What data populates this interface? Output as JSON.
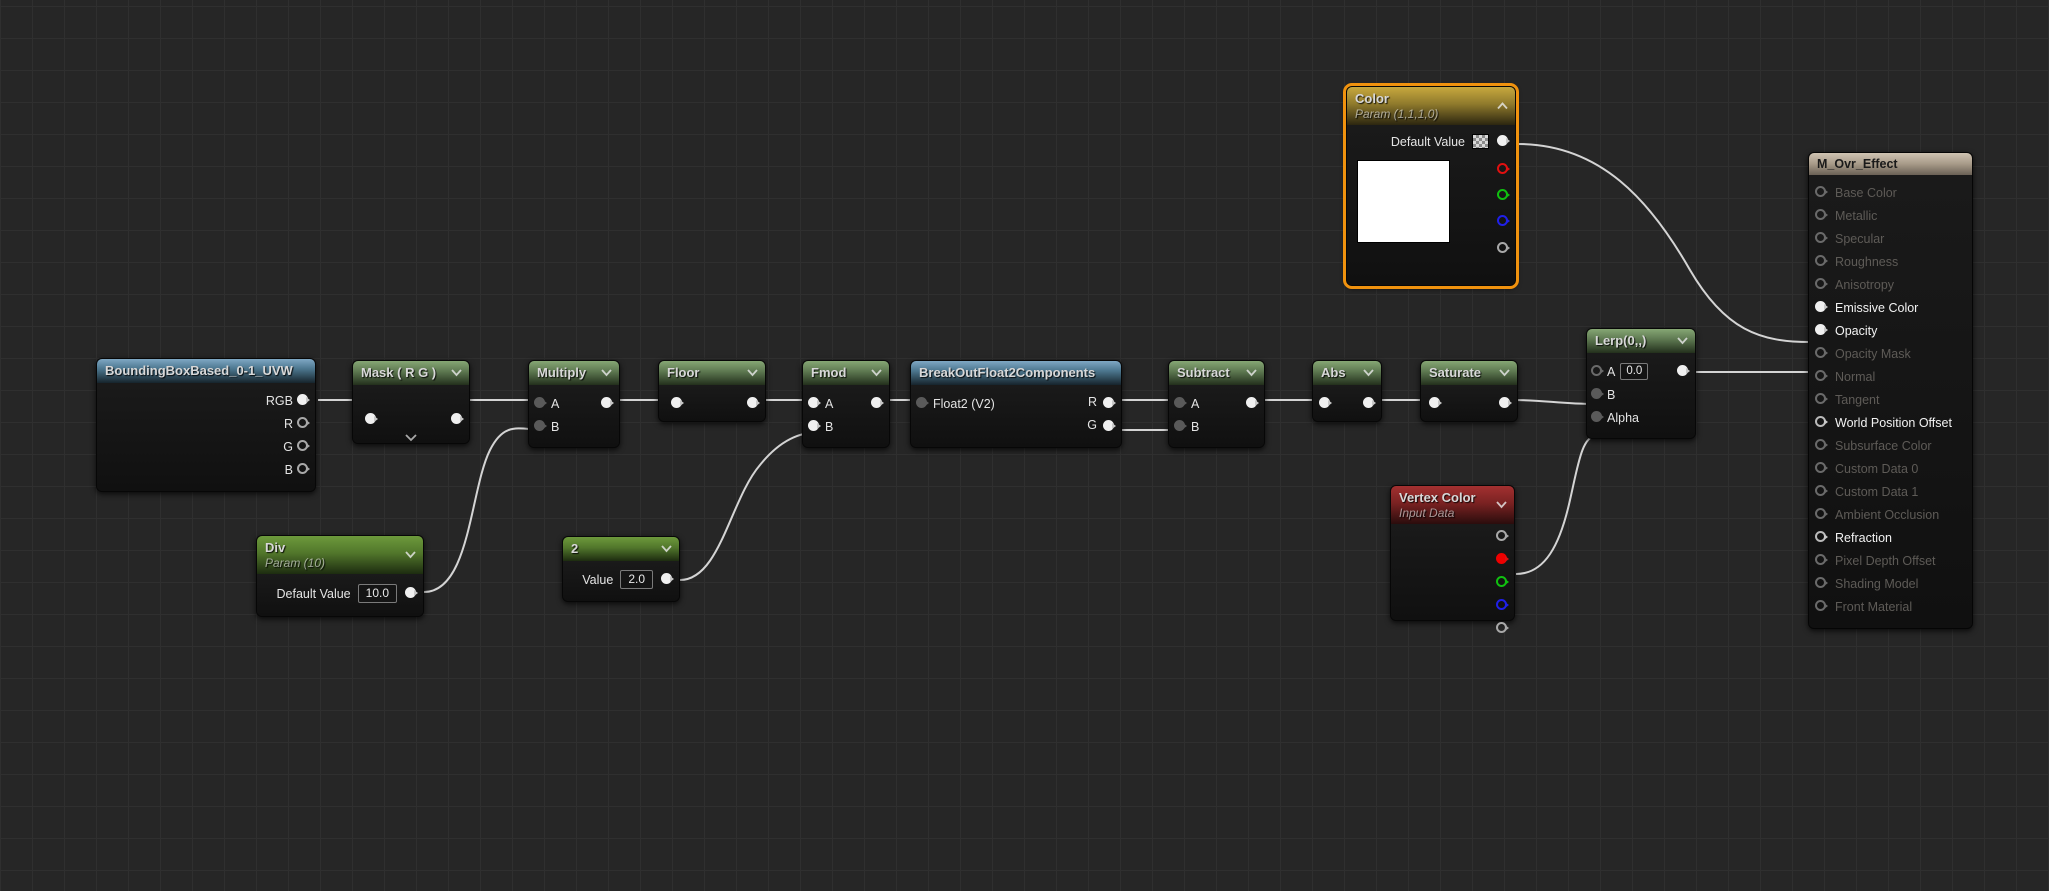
{
  "editor": {
    "type": "unreal-material-graph",
    "canvas_bg": "#262626",
    "grid_minor": "#2f2f2f",
    "grid_major": "#141414",
    "selection_color": "#f0920e"
  },
  "nodes": {
    "boundingbox": {
      "title": "BoundingBoxBased_0-1_UVW",
      "outputs": [
        "RGB",
        "R",
        "G",
        "B"
      ]
    },
    "mask": {
      "title": "Mask ( R G )"
    },
    "multiply": {
      "title": "Multiply",
      "inputs": [
        "A",
        "B"
      ]
    },
    "floor": {
      "title": "Floor"
    },
    "fmod": {
      "title": "Fmod",
      "inputs": [
        "A",
        "B"
      ]
    },
    "breakout": {
      "title": "BreakOutFloat2Components",
      "input": "Float2 (V2)",
      "outputs": [
        "R",
        "G"
      ]
    },
    "subtract": {
      "title": "Subtract",
      "inputs": [
        "A",
        "B"
      ]
    },
    "abs": {
      "title": "Abs"
    },
    "saturate": {
      "title": "Saturate"
    },
    "lerp": {
      "title": "Lerp(0,,)",
      "input_a_label": "A",
      "input_a_value": "0.0",
      "input_b_label": "B",
      "input_alpha_label": "Alpha"
    },
    "div": {
      "title": "Div",
      "subtitle": "Param (10)",
      "value_label": "Default Value",
      "value": "10.0"
    },
    "const2": {
      "title": "2",
      "value_label": "Value",
      "value": "2.0"
    },
    "color": {
      "title": "Color",
      "subtitle": "Param (1,1,1,0)",
      "value_label": "Default Value",
      "selected": true,
      "swatch_color": "#ffffff"
    },
    "vertexcolor": {
      "title": "Vertex Color",
      "subtitle": "Input Data"
    }
  },
  "material": {
    "title": "M_Ovr_Effect",
    "inputs": [
      {
        "label": "Base Color",
        "connected": false,
        "filled": false
      },
      {
        "label": "Metallic",
        "connected": false,
        "filled": false
      },
      {
        "label": "Specular",
        "connected": false,
        "filled": false
      },
      {
        "label": "Roughness",
        "connected": false,
        "filled": false
      },
      {
        "label": "Anisotropy",
        "connected": false,
        "filled": false
      },
      {
        "label": "Emissive Color",
        "connected": true,
        "filled": true
      },
      {
        "label": "Opacity",
        "connected": true,
        "filled": true
      },
      {
        "label": "Opacity Mask",
        "connected": false,
        "filled": false
      },
      {
        "label": "Normal",
        "connected": false,
        "filled": false
      },
      {
        "label": "Tangent",
        "connected": false,
        "filled": false
      },
      {
        "label": "World Position Offset",
        "connected": true,
        "filled": false
      },
      {
        "label": "Subsurface Color",
        "connected": false,
        "filled": false
      },
      {
        "label": "Custom Data 0",
        "connected": false,
        "filled": false
      },
      {
        "label": "Custom Data 1",
        "connected": false,
        "filled": false
      },
      {
        "label": "Ambient Occlusion",
        "connected": false,
        "filled": false
      },
      {
        "label": "Refraction",
        "connected": true,
        "filled": false
      },
      {
        "label": "Pixel Depth Offset",
        "connected": false,
        "filled": false
      },
      {
        "label": "Shading Model",
        "connected": false,
        "filled": false
      },
      {
        "label": "Front Material",
        "connected": false,
        "filled": false
      }
    ]
  }
}
